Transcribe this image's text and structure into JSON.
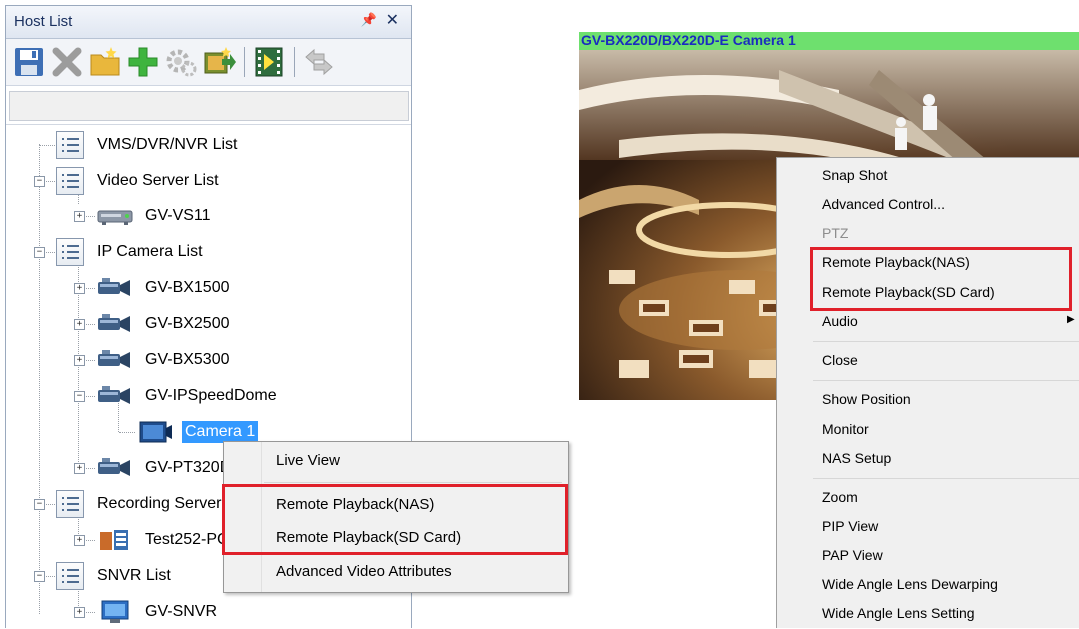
{
  "host_list": {
    "title": "Host List",
    "pin_glyph": "ᚁ",
    "close_glyph": "✕",
    "toolbar": [
      {
        "name": "save-icon"
      },
      {
        "name": "delete-icon"
      },
      {
        "name": "new-folder-icon"
      },
      {
        "name": "add-icon"
      },
      {
        "name": "settings-icon"
      },
      {
        "name": "import-icon"
      },
      {
        "name": "playback-icon"
      },
      {
        "name": "move-icon"
      }
    ],
    "filter_value": "",
    "tree": [
      {
        "id": "vms",
        "label": "VMS/DVR/NVR List",
        "icon": "list"
      },
      {
        "id": "video-server",
        "label": "Video Server List",
        "icon": "list",
        "expander": "−"
      },
      {
        "id": "gv-vs11",
        "label": "GV-VS11",
        "icon": "server",
        "expander": "+"
      },
      {
        "id": "ip-camera",
        "label": "IP Camera List",
        "icon": "list",
        "expander": "−"
      },
      {
        "id": "gv-bx1500",
        "label": "GV-BX1500",
        "icon": "camera",
        "expander": "+"
      },
      {
        "id": "gv-bx2500",
        "label": "GV-BX2500",
        "icon": "camera",
        "expander": "+"
      },
      {
        "id": "gv-bx5300",
        "label": "GV-BX5300",
        "icon": "camera",
        "expander": "+"
      },
      {
        "id": "gv-ipspeeddome",
        "label": "GV-IPSpeedDome",
        "icon": "camera",
        "expander": "−"
      },
      {
        "id": "camera-1",
        "label": "Camera 1",
        "icon": "monitor-cam",
        "selected": true
      },
      {
        "id": "gv-pt320d",
        "label": "GV-PT320D",
        "icon": "camera",
        "expander": "+"
      },
      {
        "id": "recording-server",
        "label": "Recording Server List",
        "icon": "list",
        "expander": "−"
      },
      {
        "id": "test252",
        "label": "Test252-PC",
        "icon": "recorder",
        "expander": "+"
      },
      {
        "id": "snvr",
        "label": "SNVR List",
        "icon": "list",
        "expander": "−"
      },
      {
        "id": "gv-snvr",
        "label": "GV-SNVR",
        "icon": "monitor",
        "expander": "+"
      }
    ]
  },
  "left_menu": {
    "items": [
      "Live View",
      "Remote Playback(NAS)",
      "Remote Playback(SD Card)",
      "Advanced Video Attributes"
    ]
  },
  "camera_view": {
    "title": "GV-BX220D/BX220D-E Camera 1"
  },
  "right_menu": {
    "items": [
      {
        "label": "Snap Shot"
      },
      {
        "label": "Advanced Control..."
      },
      {
        "label": "PTZ",
        "disabled": true
      },
      {
        "label": "Remote Playback(NAS)"
      },
      {
        "label": "Remote Playback(SD Card)"
      },
      {
        "label": "Audio",
        "submenu": true
      },
      {
        "label": "Close"
      },
      {
        "label": "Show Position"
      },
      {
        "label": "Monitor"
      },
      {
        "label": "NAS Setup"
      },
      {
        "label": "Zoom"
      },
      {
        "label": "PIP View"
      },
      {
        "label": "PAP View"
      },
      {
        "label": "Wide Angle Lens Dewarping"
      },
      {
        "label": "Wide Angle Lens Setting"
      }
    ],
    "submenu_arrow": "▶"
  },
  "colors": {
    "highlight_red": "#e0202a",
    "selection_blue": "#3399ff",
    "camera_title_bg": "#6ee06e",
    "camera_title_text": "#1a2cbf"
  }
}
